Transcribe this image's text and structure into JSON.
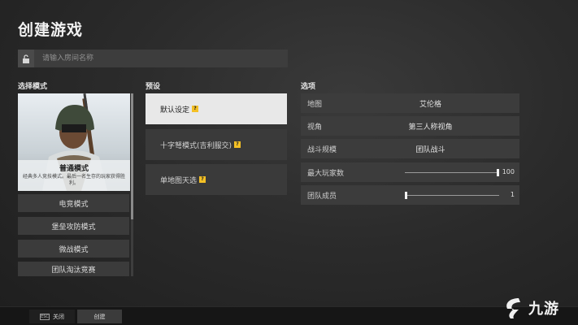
{
  "header": {
    "title": "创建游戏"
  },
  "room": {
    "placeholder": "请输入房间名称"
  },
  "modes": {
    "section_label": "选择模式",
    "hero": {
      "name": "普通模式",
      "description": "经典多人竞技模式。最后一名生存的玩家获得胜利。"
    },
    "items": [
      {
        "label": "电竞模式"
      },
      {
        "label": "堡垒攻防模式"
      },
      {
        "label": "微战模式"
      },
      {
        "label": "团队淘汰竞赛"
      }
    ]
  },
  "presets": {
    "section_label": "预设",
    "items": [
      {
        "label": "默认设定",
        "badge": "?"
      },
      {
        "label": "十字弩模式(吉利服交)",
        "badge": "?"
      },
      {
        "label": "单地图天选",
        "badge": "?"
      }
    ],
    "selected_index": 0
  },
  "options": {
    "section_label": "选项",
    "rows": [
      {
        "label": "地图",
        "value": "艾伦格"
      },
      {
        "label": "视角",
        "value": "第三人称视角"
      },
      {
        "label": "战斗规模",
        "value": "团队战斗"
      }
    ],
    "sliders": [
      {
        "label": "最大玩家数",
        "value": "100",
        "level": 1.0
      },
      {
        "label": "团队成员",
        "value": "1",
        "level": 0.0
      }
    ]
  },
  "footer": {
    "close_label": "关闭",
    "create_label": "创建",
    "close_key": "ESC"
  },
  "watermark": {
    "text": "九游"
  },
  "colors": {
    "background": "#2b2b2b",
    "panel": "#3c3c3c",
    "selected": "#e8e8e8",
    "badge": "#f4c025"
  }
}
